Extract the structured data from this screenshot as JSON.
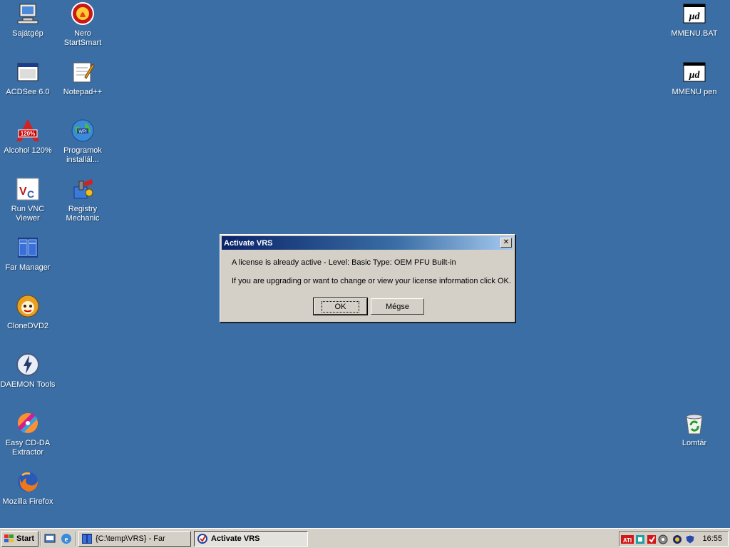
{
  "desktop": {
    "icons": [
      {
        "label": "Sajátgép",
        "icon": "my-computer-icon"
      },
      {
        "label": "Nero\nStartSmart",
        "icon": "nero-icon"
      },
      {
        "label": "MMENU.BAT",
        "icon": "batch-file-icon"
      },
      {
        "label": "ACDSee 6.0",
        "icon": "acdsee-icon"
      },
      {
        "label": "Notepad++",
        "icon": "notepad-icon"
      },
      {
        "label": "MMENU pen",
        "icon": "batch-file-icon"
      },
      {
        "label": "Alcohol 120%",
        "icon": "alcohol-icon"
      },
      {
        "label": "Programok\ninstallál...",
        "icon": "globe-icon"
      },
      {
        "label": "Run VNC\nViewer",
        "icon": "vnc-icon"
      },
      {
        "label": "Registry\nMechanic",
        "icon": "registry-mechanic-icon"
      },
      {
        "label": "Far Manager",
        "icon": "far-manager-icon"
      },
      {
        "label": "CloneDVD2",
        "icon": "clonedvd-icon"
      },
      {
        "label": "DAEMON Tools",
        "icon": "daemon-tools-icon"
      },
      {
        "label": "Easy CD-DA\nExtractor",
        "icon": "cd-extractor-icon"
      },
      {
        "label": "Lomtár",
        "icon": "recycle-bin-icon"
      },
      {
        "label": "Mozilla Firefox",
        "icon": "firefox-icon"
      }
    ]
  },
  "dialog": {
    "title": "Activate VRS",
    "close_label": "✕",
    "message_line1": "A license is already active - Level: Basic  Type: OEM PFU Built-in",
    "message_line2": "If you are upgrading or want to change or view your license information click OK.",
    "ok_label": "OK",
    "cancel_label": "Mégse"
  },
  "taskbar": {
    "start_label": "Start",
    "tasks": [
      {
        "label": "{C:\\temp\\VRS} - Far",
        "active": false
      },
      {
        "label": "Activate VRS",
        "active": true
      }
    ],
    "clock": "16:55"
  },
  "colors": {
    "desktop": "#3a6ea5",
    "titlebar_start": "#0a246a",
    "titlebar_end": "#a6caf0",
    "face": "#d4d0c8"
  }
}
